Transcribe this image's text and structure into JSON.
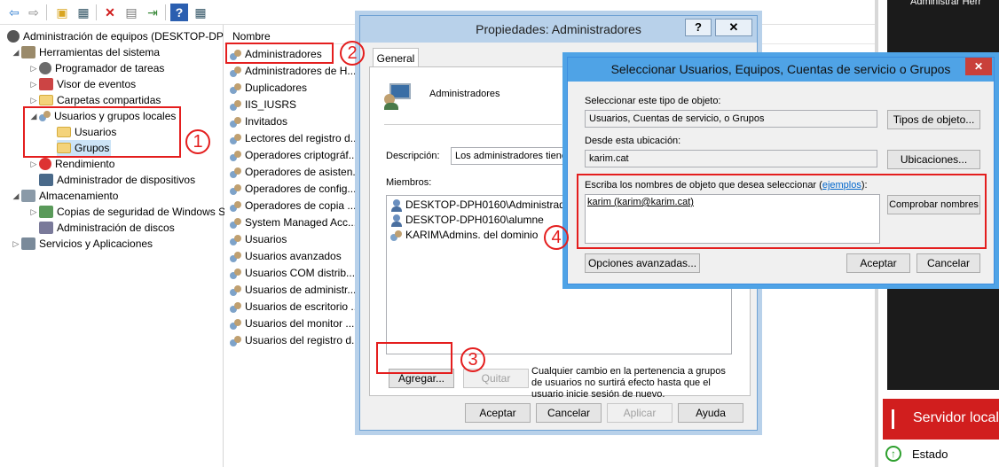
{
  "toolbar": {
    "icons": [
      "back-arrow-icon",
      "forward-arrow-icon",
      "up-folder-icon",
      "show-tree-icon",
      "delete-icon",
      "properties-icon",
      "export-icon",
      "help-icon",
      "details-icon"
    ]
  },
  "tree": {
    "items": [
      {
        "label": "Administración de equipos (DESKTOP-DP",
        "level": 0,
        "arrow": ""
      },
      {
        "label": "Herramientas del sistema",
        "level": 1,
        "arrow": "◢"
      },
      {
        "label": "Programador de tareas",
        "level": 2,
        "arrow": "▷"
      },
      {
        "label": "Visor de eventos",
        "level": 2,
        "arrow": "▷"
      },
      {
        "label": "Carpetas compartidas",
        "level": 2,
        "arrow": "▷"
      },
      {
        "label": "Usuarios y grupos locales",
        "level": 2,
        "arrow": "◢"
      },
      {
        "label": "Usuarios",
        "level": 3,
        "arrow": ""
      },
      {
        "label": "Grupos",
        "level": 3,
        "arrow": ""
      },
      {
        "label": "Rendimiento",
        "level": 2,
        "arrow": "▷"
      },
      {
        "label": "Administrador de dispositivos",
        "level": 2,
        "arrow": ""
      },
      {
        "label": "Almacenamiento",
        "level": 1,
        "arrow": "◢"
      },
      {
        "label": "Copias de seguridad de Windows S",
        "level": 2,
        "arrow": "▷"
      },
      {
        "label": "Administración de discos",
        "level": 2,
        "arrow": ""
      },
      {
        "label": "Servicios y Aplicaciones",
        "level": 1,
        "arrow": "▷"
      }
    ]
  },
  "list": {
    "header": "Nombre",
    "items": [
      "Administradores",
      "Administradores de H...",
      "Duplicadores",
      "IIS_IUSRS",
      "Invitados",
      "Lectores del registro d...",
      "Operadores criptográf...",
      "Operadores de asisten...",
      "Operadores de config...",
      "Operadores de copia ...",
      "System Managed Acc...",
      "Usuarios",
      "Usuarios avanzados",
      "Usuarios COM distrib...",
      "Usuarios de administr...",
      "Usuarios de escritorio ...",
      "Usuarios del monitor ...",
      "Usuarios del registro d..."
    ]
  },
  "properties_dialog": {
    "title": "Propiedades: Administradores",
    "help_btn": "?",
    "close_btn": "✕",
    "tab": "General",
    "group_name": "Administradores",
    "description_label": "Descripción:",
    "description_value": "Los administradores tienen",
    "members_label": "Miembros:",
    "members": [
      "DESKTOP-DPH0160\\Administrador",
      "DESKTOP-DPH0160\\alumne",
      "KARIM\\Admins. del dominio"
    ],
    "add_btn": "Agregar...",
    "remove_btn": "Quitar",
    "note": "Cualquier cambio en la pertenencia a grupos de usuarios no surtirá efecto hasta que el usuario inicie sesión de nuevo.",
    "ok_btn": "Aceptar",
    "cancel_btn": "Cancelar",
    "apply_btn": "Aplicar",
    "help2_btn": "Ayuda"
  },
  "select_dialog": {
    "title": "Seleccionar Usuarios, Equipos, Cuentas de servicio o Grupos",
    "close_btn": "✕",
    "object_type_label": "Seleccionar este tipo de objeto:",
    "object_type_value": "Usuarios, Cuentas de servicio, o Grupos",
    "object_types_btn": "Tipos de objeto...",
    "location_label": "Desde esta ubicación:",
    "location_value": "karim.cat",
    "locations_btn": "Ubicaciones...",
    "names_label": "Escriba los nombres de objeto que desea seleccionar (",
    "names_link": "ejemplos",
    "names_label_end": "):",
    "names_value": "karim (karim@karim.cat)",
    "check_names_btn": "Comprobar nombres",
    "advanced_btn": "Opciones avanzadas...",
    "ok_btn": "Aceptar",
    "cancel_btn": "Cancelar"
  },
  "annotations": [
    "1",
    "2",
    "3",
    "4"
  ],
  "right_panel": {
    "top_text": "Administrar   Herr",
    "banner_text": "Servidor local",
    "status_text": "Estado"
  }
}
